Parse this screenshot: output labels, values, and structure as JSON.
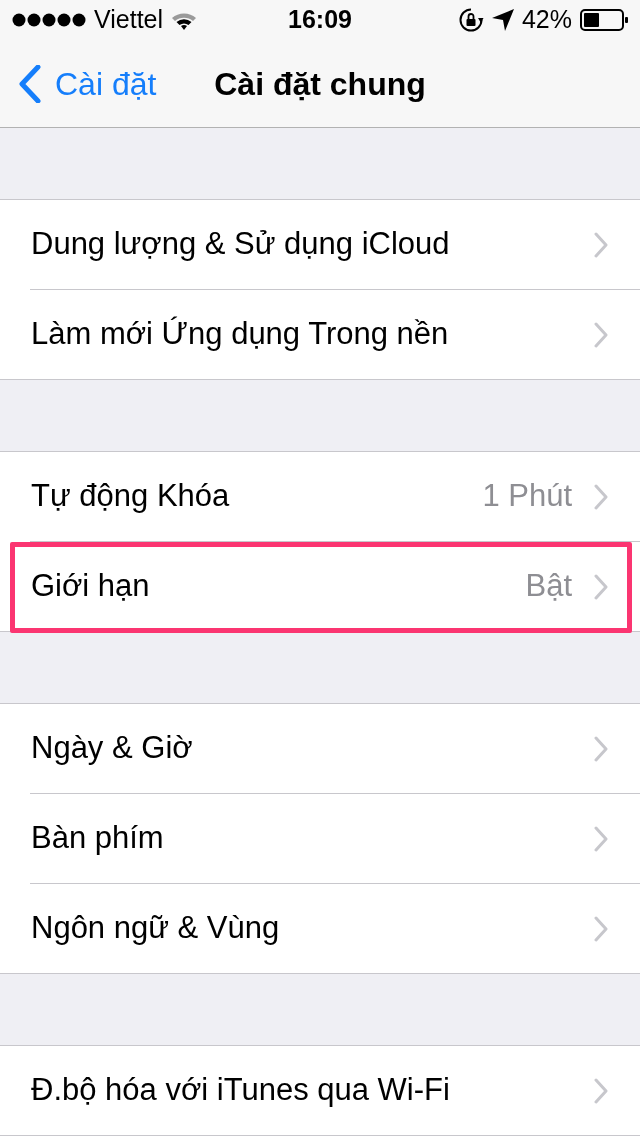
{
  "status_bar": {
    "carrier": "Viettel",
    "time": "16:09",
    "battery": "42%"
  },
  "nav_bar": {
    "back": "Cài đặt",
    "title": "Cài đặt chung"
  },
  "groups": [
    {
      "rows": [
        {
          "label": "Dung lượng & Sử dụng iCloud",
          "highlighted": false
        },
        {
          "label": "Làm mới Ứng dụng Trong nền",
          "highlighted": false
        }
      ]
    },
    {
      "rows": [
        {
          "label": "Tự động Khóa",
          "value": "1 Phút",
          "highlighted": false
        },
        {
          "label": "Giới hạn",
          "value": "Bật",
          "highlighted": true
        }
      ]
    },
    {
      "rows": [
        {
          "label": "Ngày & Giờ",
          "highlighted": false
        },
        {
          "label": "Bàn phím",
          "highlighted": false
        },
        {
          "label": "Ngôn ngữ & Vùng",
          "highlighted": false
        }
      ]
    },
    {
      "rows": [
        {
          "label": "Đ.bộ hóa với iTunes qua Wi-Fi",
          "highlighted": false
        }
      ]
    }
  ]
}
